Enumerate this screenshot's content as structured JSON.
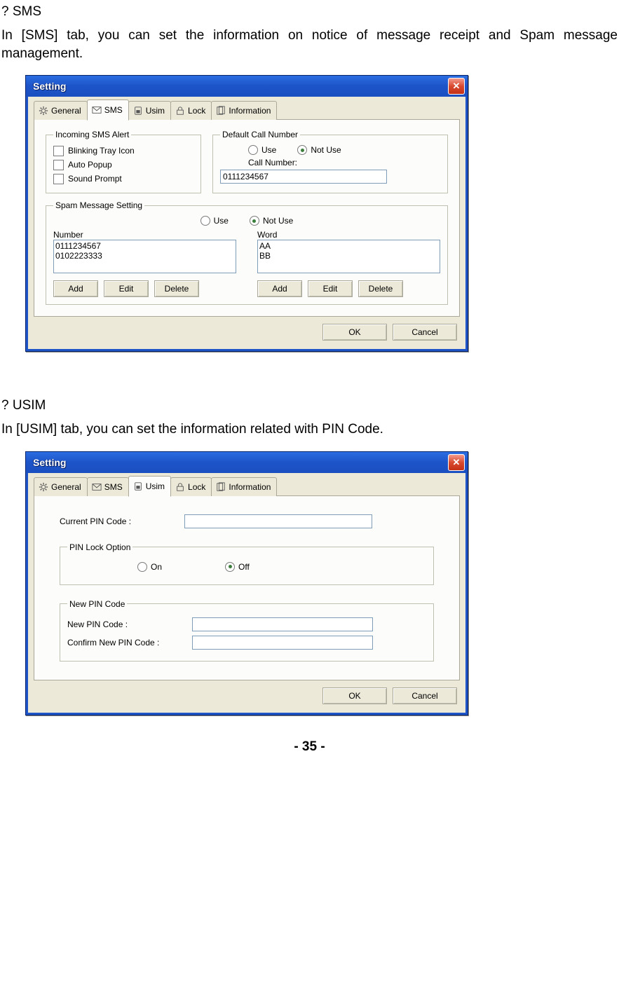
{
  "sms_section": {
    "heading": "? SMS",
    "body": "In [SMS] tab, you can set the information on notice of message receipt and Spam message management."
  },
  "usim_section": {
    "heading": "? USIM",
    "body": "In [USIM] tab, you can set the information related with PIN Code."
  },
  "page_number": "- 35 -",
  "win_title": "Setting",
  "tabs": {
    "general": "General",
    "sms": "SMS",
    "usim": "Usim",
    "lock": "Lock",
    "information": "Information"
  },
  "sms_dialog": {
    "incoming_alert": {
      "legend": "Incoming SMS Alert",
      "blinking": "Blinking Tray Icon",
      "popup": "Auto Popup",
      "sound": "Sound Prompt"
    },
    "default_call": {
      "legend": "Default Call Number",
      "use": "Use",
      "not_use": "Not Use",
      "call_number_label": "Call Number:",
      "call_number_value": "0111234567"
    },
    "spam": {
      "legend": "Spam Message Setting",
      "use": "Use",
      "not_use": "Not Use",
      "number_label": "Number",
      "word_label": "Word",
      "numbers": [
        "0111234567",
        "0102223333"
      ],
      "words": [
        "AA",
        "BB"
      ]
    },
    "buttons": {
      "add": "Add",
      "edit": "Edit",
      "delete": "Delete"
    }
  },
  "usim_dialog": {
    "current_pin_label": "Current PIN Code  :",
    "pin_lock": {
      "legend": "PIN Lock Option",
      "on": "On",
      "off": "Off"
    },
    "new_pin": {
      "legend": "New PIN Code",
      "new_label": "New PIN Code  :",
      "confirm_label": "Confirm New PIN Code  :"
    }
  },
  "footer": {
    "ok": "OK",
    "cancel": "Cancel"
  }
}
